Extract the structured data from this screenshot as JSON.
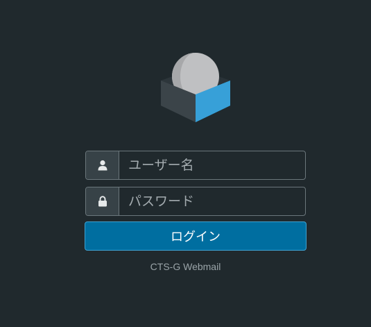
{
  "logo": {
    "icon": "roundcube-logo-icon"
  },
  "login_form": {
    "username": {
      "icon": "user-icon",
      "placeholder": "ユーザー名",
      "value": ""
    },
    "password": {
      "icon": "lock-icon",
      "placeholder": "パスワード",
      "value": ""
    },
    "submit_label": "ログイン"
  },
  "footer": {
    "product_name": "CTS-G Webmail"
  },
  "colors": {
    "background": "#20292d",
    "accent": "#006ea0",
    "field_border": "#6b777c"
  }
}
